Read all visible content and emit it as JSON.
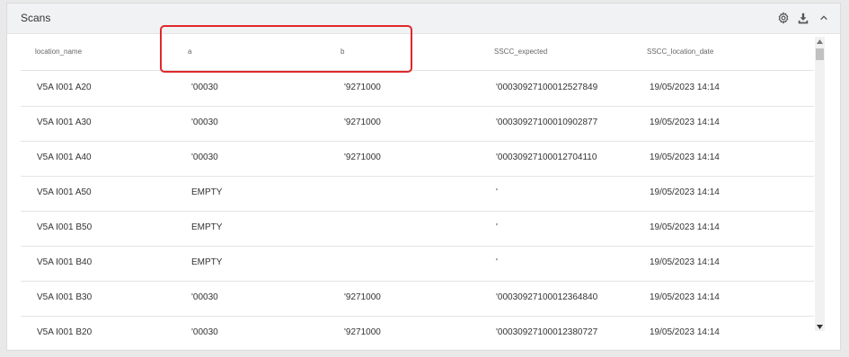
{
  "panel": {
    "title": "Scans",
    "icons": [
      "gear-icon",
      "download-icon",
      "chevron-up-icon"
    ]
  },
  "table": {
    "columns": [
      "location_name",
      "a",
      "b",
      "SSCC_expected",
      "SSCC_location_date"
    ],
    "rows": [
      {
        "location_name": "V5A I001 A20",
        "a": "'00030",
        "b": "'9271000",
        "sscc_expected": "'00030927100012527849",
        "sscc_location_date": "19/05/2023 14:14"
      },
      {
        "location_name": "V5A I001 A30",
        "a": "'00030",
        "b": "'9271000",
        "sscc_expected": "'00030927100010902877",
        "sscc_location_date": "19/05/2023 14:14"
      },
      {
        "location_name": "V5A I001 A40",
        "a": "'00030",
        "b": "'9271000",
        "sscc_expected": "'00030927100012704110",
        "sscc_location_date": "19/05/2023 14:14"
      },
      {
        "location_name": "V5A I001 A50",
        "a": "EMPTY",
        "b": "",
        "sscc_expected": "'",
        "sscc_location_date": "19/05/2023 14:14"
      },
      {
        "location_name": "V5A I001 B50",
        "a": "EMPTY",
        "b": "",
        "sscc_expected": "'",
        "sscc_location_date": "19/05/2023 14:14"
      },
      {
        "location_name": "V5A I001 B40",
        "a": "EMPTY",
        "b": "",
        "sscc_expected": "'",
        "sscc_location_date": "19/05/2023 14:14"
      },
      {
        "location_name": "V5A I001 B30",
        "a": "'00030",
        "b": "'9271000",
        "sscc_expected": "'00030927100012364840",
        "sscc_location_date": "19/05/2023 14:14"
      },
      {
        "location_name": "V5A I001 B20",
        "a": "'00030",
        "b": "'9271000",
        "sscc_expected": "'00030927100012380727",
        "sscc_location_date": "19/05/2023 14:14"
      }
    ]
  },
  "colors": {
    "highlight": "#e0272b",
    "header_bg": "#f1f2f4"
  }
}
